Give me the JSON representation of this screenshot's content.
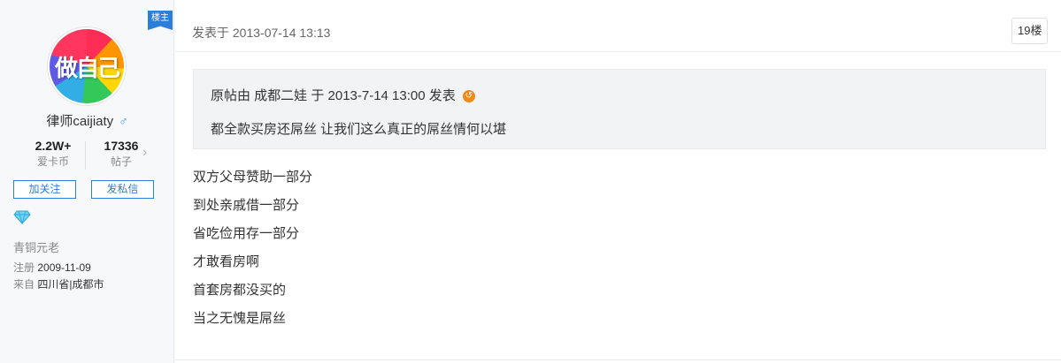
{
  "user": {
    "op_badge": "楼主",
    "avatar_text": "做自己",
    "name": "律师caijiaty",
    "gender_icon": "male-icon",
    "stats": [
      {
        "value": "2.2W+",
        "label": "爱卡币"
      },
      {
        "value": "17336",
        "label": "帖子"
      }
    ],
    "follow_label": "加关注",
    "message_label": "发私信",
    "badge_icon": "diamond-icon",
    "level": "青铜元老",
    "register_label": "注册",
    "register_date": "2009-11-09",
    "location_label": "来自",
    "location": "四川省|成都市"
  },
  "post": {
    "time": "发表于 2013-07-14 13:13",
    "floor": "19楼",
    "quote": {
      "header": "原帖由 成都二娃 于 2013-7-14 13:00 发表",
      "back_icon": "return-arrow-icon",
      "text": "都全款买房还屌丝 让我们这么真正的屌丝情何以堪"
    },
    "lines": [
      "双方父母赞助一部分",
      "到处亲戚借一部分",
      "省吃俭用存一部分",
      "才敢看房啊",
      "首套房都没买的",
      "当之无愧是屌丝"
    ]
  },
  "colors": {
    "accent": "#2d7ed8",
    "sidebar_bg": "#f7f8fa",
    "quote_bg": "#f2f3f5",
    "back_icon": "#f08a1a"
  }
}
